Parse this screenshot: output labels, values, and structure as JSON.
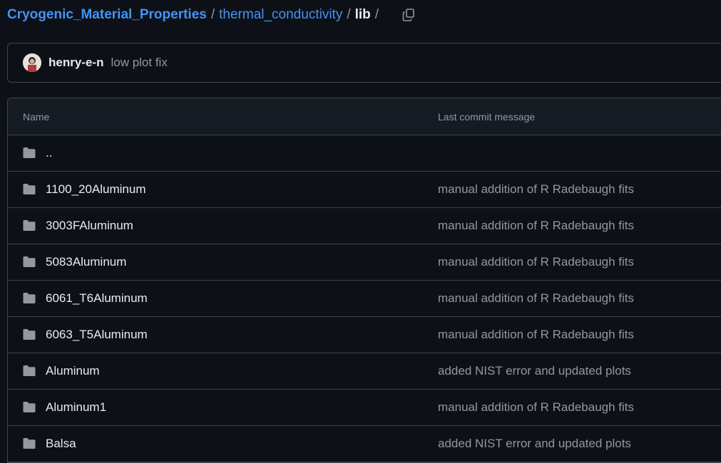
{
  "breadcrumb": {
    "repo": "Cryogenic_Material_Properties",
    "folder": "thermal_conductivity",
    "current": "lib",
    "separator": "/"
  },
  "copy_icon": "copy-icon",
  "latest_commit": {
    "author": "henry-e-n",
    "message": "low plot fix"
  },
  "table": {
    "headers": {
      "name": "Name",
      "last_commit_message": "Last commit message"
    },
    "rows": [
      {
        "name": "..",
        "message": ""
      },
      {
        "name": "1100_20Aluminum",
        "message": "manual addition of R Radebaugh fits"
      },
      {
        "name": "3003FAluminum",
        "message": "manual addition of R Radebaugh fits"
      },
      {
        "name": "5083Aluminum",
        "message": "manual addition of R Radebaugh fits"
      },
      {
        "name": "6061_T6Aluminum",
        "message": "manual addition of R Radebaugh fits"
      },
      {
        "name": "6063_T5Aluminum",
        "message": "manual addition of R Radebaugh fits"
      },
      {
        "name": "Aluminum",
        "message": "added NIST error and updated plots"
      },
      {
        "name": "Aluminum1",
        "message": "manual addition of R Radebaugh fits"
      },
      {
        "name": "Balsa",
        "message": "added NIST error and updated plots"
      }
    ]
  },
  "colors": {
    "background": "#0d1117",
    "link": "#4493f8",
    "muted": "#9198a1",
    "border": "#3d444d",
    "folder_icon": "#9198a1"
  }
}
